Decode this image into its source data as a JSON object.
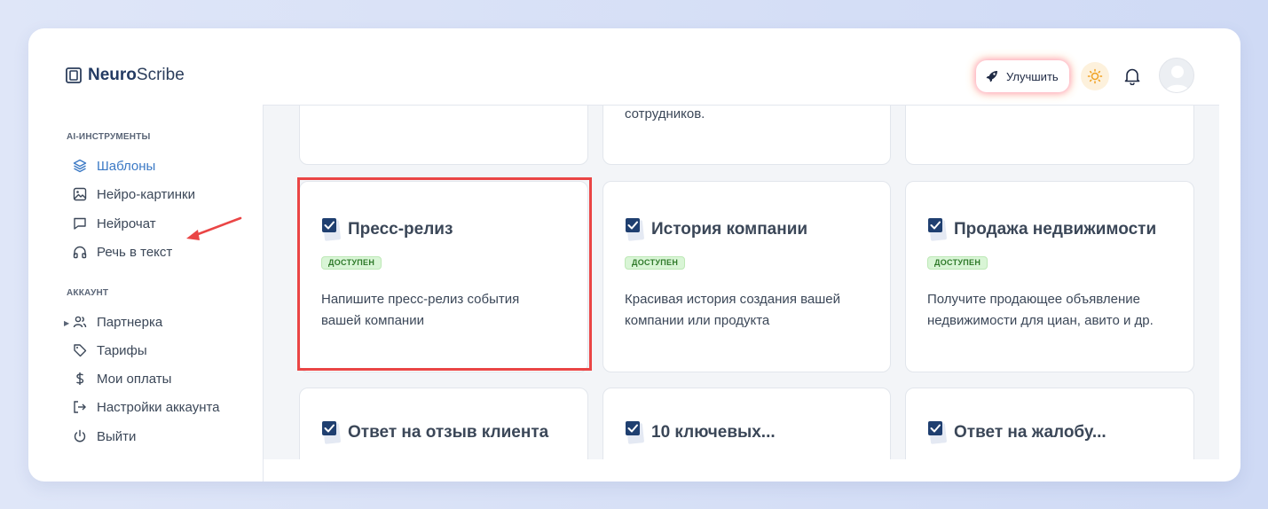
{
  "app": {
    "brand_part1": "Neuro",
    "brand_part2": "Scribe"
  },
  "header": {
    "upgrade_label": "Улучшить",
    "icons": [
      "rocket-icon",
      "sun-icon",
      "bell-icon",
      "avatar"
    ]
  },
  "sidebar": {
    "tools_title": "AI-ИНСТРУМЕНТЫ",
    "tools": [
      {
        "label": "Шаблоны",
        "icon": "layers-icon",
        "active": true
      },
      {
        "label": "Нейро-картинки",
        "icon": "image-icon"
      },
      {
        "label": "Нейрочат",
        "icon": "chat-icon"
      },
      {
        "label": "Речь в текст",
        "icon": "headphones-icon"
      }
    ],
    "account_title": "АККАУНТ",
    "account": [
      {
        "label": "Партнерка",
        "icon": "users-icon"
      },
      {
        "label": "Тарифы",
        "icon": "tag-icon"
      },
      {
        "label": "Мои оплаты",
        "icon": "dollar-icon"
      },
      {
        "label": "Настройки аккаунта",
        "icon": "logout-arrow-icon"
      },
      {
        "label": "Выйти",
        "icon": "power-icon"
      }
    ]
  },
  "cards": {
    "top_partial_text": "сотрудников.",
    "row2": [
      {
        "title": "Пресс-релиз",
        "badge": "ДОСТУПЕН",
        "desc": "Напишите пресс-релиз события вашей компании"
      },
      {
        "title": "История компании",
        "badge": "ДОСТУПЕН",
        "desc": "Красивая история создания вашей компании или продукта"
      },
      {
        "title": "Продажа недвижимости",
        "badge": "ДОСТУПЕН",
        "desc": "Получите продающее объявление недвижимости для циан, авито и др."
      }
    ],
    "row3": [
      {
        "title": "Ответ на отзыв клиента"
      },
      {
        "title": "10 ключевых..."
      },
      {
        "title": "Ответ на жалобу..."
      }
    ]
  },
  "colors": {
    "accent": "#3b79c5",
    "highlight": "#ea4545",
    "badge_bg": "#d9f5d6",
    "badge_text": "#2f7a2a"
  }
}
